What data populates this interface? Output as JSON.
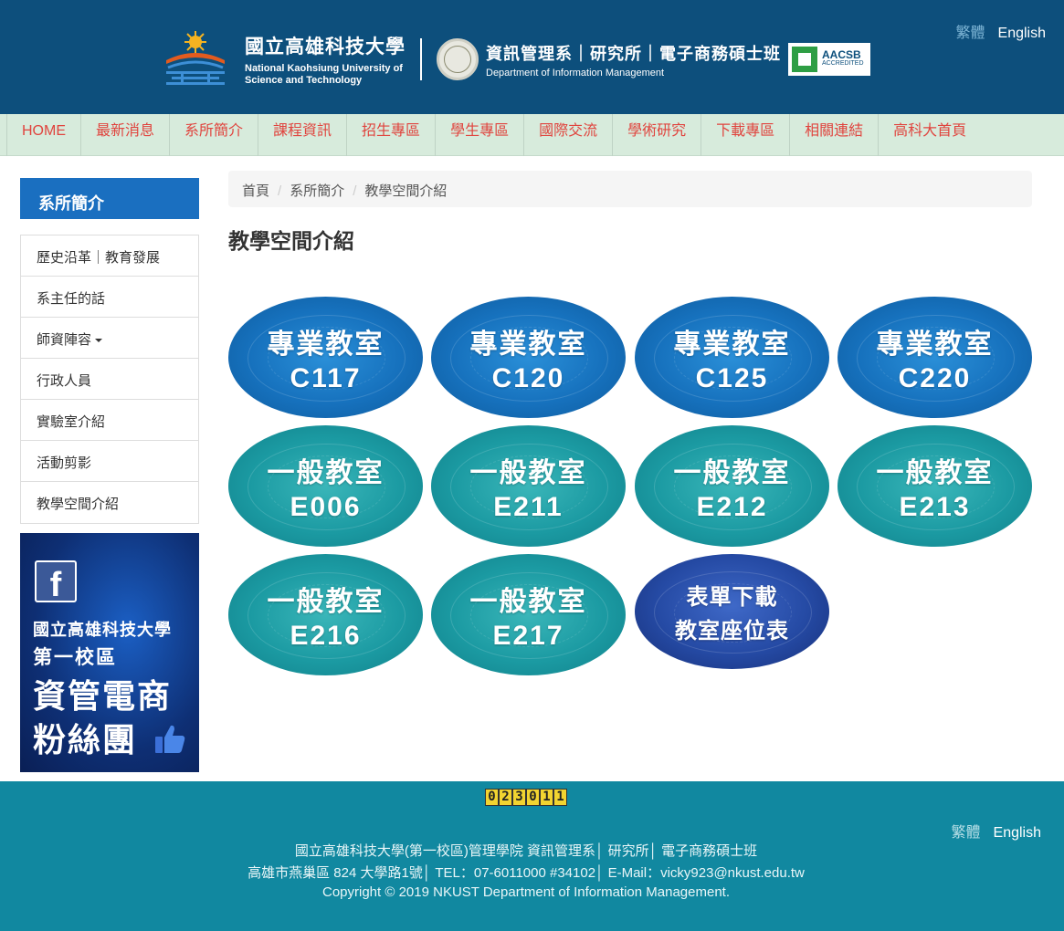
{
  "header": {
    "university_cn": "國立高雄科技大學",
    "university_en_1": "National Kaohsiung University of",
    "university_en_2": "Science and Technology",
    "dept_cn": "資訊管理系｜研究所｜電子商務碩士班",
    "dept_en": "Department of Information Management",
    "accreditation": "AACSB",
    "accreditation_sub": "ACCREDITED",
    "lang_traditional": "繁體",
    "lang_english": "English"
  },
  "nav": {
    "items": [
      "HOME",
      "最新消息",
      "系所簡介",
      "課程資訊",
      "招生專區",
      "學生專區",
      "國際交流",
      "學術研究",
      "下載專區",
      "相關連結",
      "高科大首頁"
    ]
  },
  "sidebar": {
    "heading": "系所簡介",
    "items": [
      "歷史沿革｜教育發展",
      "系主任的話",
      "師資陣容",
      "行政人員",
      "實驗室介紹",
      "活動剪影",
      "教學空間介紹"
    ],
    "banner": {
      "line1": "國立高雄科技大學",
      "line2": "第一校區",
      "line3": "資管電商",
      "line4": "粉絲團"
    }
  },
  "breadcrumb": [
    "首頁",
    "系所簡介",
    "教學空間介紹"
  ],
  "page_title": "教學空間介紹",
  "rooms": [
    {
      "line1": "專業教室",
      "line2": "C117"
    },
    {
      "line1": "專業教室",
      "line2": "C120"
    },
    {
      "line1": "專業教室",
      "line2": "C125"
    },
    {
      "line1": "專業教室",
      "line2": "C220"
    },
    {
      "line1": "一般教室",
      "line2": "E006"
    },
    {
      "line1": "一般教室",
      "line2": "E211"
    },
    {
      "line1": "一般教室",
      "line2": "E212"
    },
    {
      "line1": "一般教室",
      "line2": "E213"
    },
    {
      "line1": "一般教室",
      "line2": "E216"
    },
    {
      "line1": "一般教室",
      "line2": "E217"
    },
    {
      "line1": "表單下載",
      "line2": "教室座位表"
    }
  ],
  "footer": {
    "counter": [
      "0",
      "2",
      "3",
      "0",
      "1",
      "1"
    ],
    "lang_traditional": "繁體",
    "lang_english": "English",
    "line1": "國立高雄科技大學(第一校區)管理學院 資訊管理系│ 研究所│ 電子商務碩士班",
    "line2": "高雄市燕巢區 824 大學路1號│ TEL：07-6011000 #34102│ E-Mail：vicky923@nkust.edu.tw",
    "line3": "Copyright © 2019 NKUST Department of Information Management."
  },
  "colors": {
    "header_bg": "#0d4f7c",
    "nav_bg": "#d7ebdc",
    "nav_text": "#e0443e",
    "sidebar_head": "#1a6fc0",
    "footer_bg": "#1188a0"
  }
}
